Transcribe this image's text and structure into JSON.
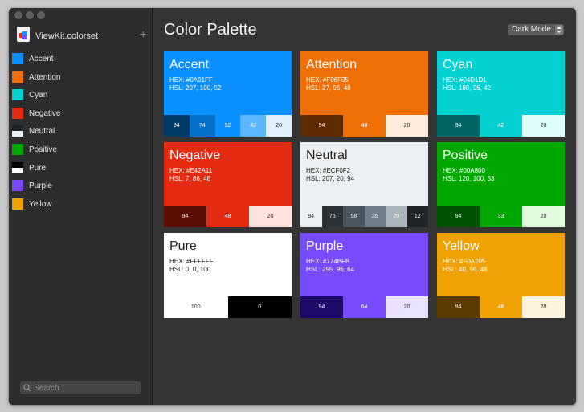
{
  "window": {
    "set_name": "ViewKit.colorset"
  },
  "header": {
    "title": "Color Palette",
    "mode_label": "Dark Mode"
  },
  "search": {
    "placeholder": "Search"
  },
  "sidebar": {
    "items": [
      {
        "label": "Accent",
        "colors": [
          "#0A91FF"
        ]
      },
      {
        "label": "Attention",
        "colors": [
          "#F06F05"
        ]
      },
      {
        "label": "Cyan",
        "colors": [
          "#04D1D1"
        ]
      },
      {
        "label": "Negative",
        "colors": [
          "#E42A11"
        ]
      },
      {
        "label": "Neutral",
        "colors": [
          "#1F2326",
          "#ECF0F2"
        ]
      },
      {
        "label": "Positive",
        "colors": [
          "#00A800"
        ]
      },
      {
        "label": "Pure",
        "colors": [
          "#000000",
          "#FFFFFF"
        ]
      },
      {
        "label": "Purple",
        "colors": [
          "#774BFB"
        ]
      },
      {
        "label": "Yellow",
        "colors": [
          "#F0A205"
        ]
      }
    ]
  },
  "cards": [
    {
      "name": "Accent",
      "hex": "HEX: #0A91FF",
      "hsl": "HSL: 207, 100, 52",
      "color": "#0A91FF",
      "text_color": "#FFFFFF",
      "shades": [
        {
          "label": "94",
          "color": "#003A66",
          "text_color": "#FFFFFF"
        },
        {
          "label": "74",
          "color": "#0570C9",
          "text_color": "#FFFFFF"
        },
        {
          "label": "52",
          "color": "#0A91FF",
          "text_color": "#FFFFFF"
        },
        {
          "label": "42",
          "color": "#5CB6FF",
          "text_color": "#FFFFFF"
        },
        {
          "label": "20",
          "color": "#E1F0FF",
          "text_color": "#222222"
        }
      ]
    },
    {
      "name": "Attention",
      "hex": "HEX: #F06F05",
      "hsl": "HSL: 27, 96, 48",
      "color": "#F06F05",
      "text_color": "#FFFFFF",
      "shades": [
        {
          "label": "94",
          "color": "#5E2A02",
          "text_color": "#FFFFFF"
        },
        {
          "label": "48",
          "color": "#F06F05",
          "text_color": "#FFFFFF"
        },
        {
          "label": "20",
          "color": "#FDEBDC",
          "text_color": "#222222"
        }
      ]
    },
    {
      "name": "Cyan",
      "hex": "HEX: #04D1D1",
      "hsl": "HSL: 180, 96, 42",
      "color": "#04D1D1",
      "text_color": "#FFFFFF",
      "shades": [
        {
          "label": "94",
          "color": "#016563",
          "text_color": "#FFFFFF"
        },
        {
          "label": "42",
          "color": "#04D1D1",
          "text_color": "#FFFFFF"
        },
        {
          "label": "20",
          "color": "#DEFCFC",
          "text_color": "#222222"
        }
      ]
    },
    {
      "name": "Negative",
      "hex": "HEX: #E42A11",
      "hsl": "HSL: 7, 86, 48",
      "color": "#E42A11",
      "text_color": "#FFFFFF",
      "shades": [
        {
          "label": "94",
          "color": "#5C0D04",
          "text_color": "#FFFFFF"
        },
        {
          "label": "48",
          "color": "#E42A11",
          "text_color": "#FFFFFF"
        },
        {
          "label": "20",
          "color": "#FDE2DE",
          "text_color": "#222222"
        }
      ]
    },
    {
      "name": "Neutral",
      "hex": "HEX: #ECF0F2",
      "hsl": "HSL: 207, 20, 94",
      "color": "#ECF0F2",
      "text_color": "#222222",
      "shades": [
        {
          "label": "94",
          "color": "#ECF0F2",
          "text_color": "#222222"
        },
        {
          "label": "76",
          "color": "#2C3338",
          "text_color": "#FFFFFF"
        },
        {
          "label": "58",
          "color": "#4A5660",
          "text_color": "#FFFFFF"
        },
        {
          "label": "35",
          "color": "#6F7D89",
          "text_color": "#FFFFFF"
        },
        {
          "label": "20",
          "color": "#A9B4BC",
          "text_color": "#FFFFFF"
        },
        {
          "label": "12",
          "color": "#1F2326",
          "text_color": "#FFFFFF"
        }
      ]
    },
    {
      "name": "Positive",
      "hex": "HEX: #00A800",
      "hsl": "HSL: 120, 100, 33",
      "color": "#00A800",
      "text_color": "#FFFFFF",
      "shades": [
        {
          "label": "94",
          "color": "#005100",
          "text_color": "#FFFFFF"
        },
        {
          "label": "33",
          "color": "#00A800",
          "text_color": "#FFFFFF"
        },
        {
          "label": "20",
          "color": "#E2FBDF",
          "text_color": "#222222"
        }
      ]
    },
    {
      "name": "Pure",
      "hex": "HEX: #FFFFFF",
      "hsl": "HSL: 0, 0, 100",
      "color": "#FFFFFF",
      "text_color": "#222222",
      "shades": [
        {
          "label": "100",
          "color": "#FFFFFF",
          "text_color": "#222222"
        },
        {
          "label": "0",
          "color": "#000000",
          "text_color": "#FFFFFF"
        }
      ]
    },
    {
      "name": "Purple",
      "hex": "HEX: #774BFB",
      "hsl": "HSL: 255, 96, 64",
      "color": "#774BFB",
      "text_color": "#FFFFFF",
      "shades": [
        {
          "label": "94",
          "color": "#1D0A69",
          "text_color": "#FFFFFF"
        },
        {
          "label": "64",
          "color": "#774BFB",
          "text_color": "#FFFFFF"
        },
        {
          "label": "20",
          "color": "#E9E2FE",
          "text_color": "#222222"
        }
      ]
    },
    {
      "name": "Yellow",
      "hex": "HEX: #F0A205",
      "hsl": "HSL: 40, 96, 48",
      "color": "#F0A205",
      "text_color": "#FFFFFF",
      "shades": [
        {
          "label": "94",
          "color": "#5B3B02",
          "text_color": "#FFFFFF"
        },
        {
          "label": "48",
          "color": "#F0A205",
          "text_color": "#FFFFFF"
        },
        {
          "label": "20",
          "color": "#FEF3DC",
          "text_color": "#222222"
        }
      ]
    }
  ]
}
